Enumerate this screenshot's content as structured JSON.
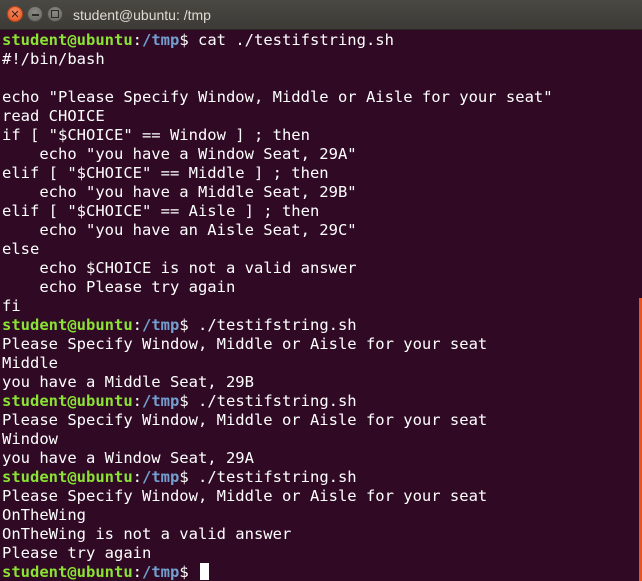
{
  "window": {
    "title": "student@ubuntu: /tmp",
    "close_glyph": "✕",
    "accent_color": "#e95420"
  },
  "prompt": {
    "user_host": "student@ubuntu",
    "sep": ":",
    "path": "/tmp",
    "suffix": "$"
  },
  "colors": {
    "background": "#300a24",
    "prompt_user": "#8ae234",
    "prompt_path": "#729fcf",
    "text": "#ffffff"
  },
  "terminal": {
    "line_00": " cat ./testifstring.sh",
    "line_01": "#!/bin/bash",
    "line_02": "",
    "line_03": "echo \"Please Specify Window, Middle or Aisle for your seat\"",
    "line_04": "read CHOICE",
    "line_05": "if [ \"$CHOICE\" == Window ] ; then",
    "line_06": "    echo \"you have a Window Seat, 29A\"",
    "line_07": "elif [ \"$CHOICE\" == Middle ] ; then",
    "line_08": "    echo \"you have a Middle Seat, 29B\"",
    "line_09": "elif [ \"$CHOICE\" == Aisle ] ; then",
    "line_10": "    echo \"you have an Aisle Seat, 29C\"",
    "line_11": "else",
    "line_12": "    echo $CHOICE is not a valid answer",
    "line_13": "    echo Please try again",
    "line_14": "fi",
    "line_15": " ./testifstring.sh",
    "line_16": "Please Specify Window, Middle or Aisle for your seat",
    "line_17": "Middle",
    "line_18": "you have a Middle Seat, 29B",
    "line_19": " ./testifstring.sh",
    "line_20": "Please Specify Window, Middle or Aisle for your seat",
    "line_21": "Window",
    "line_22": "you have a Window Seat, 29A",
    "line_23": " ./testifstring.sh",
    "line_24": "Please Specify Window, Middle or Aisle for your seat",
    "line_25": "OnTheWing",
    "line_26": "OnTheWing is not a valid answer",
    "line_27": "Please try again",
    "line_28": " "
  }
}
